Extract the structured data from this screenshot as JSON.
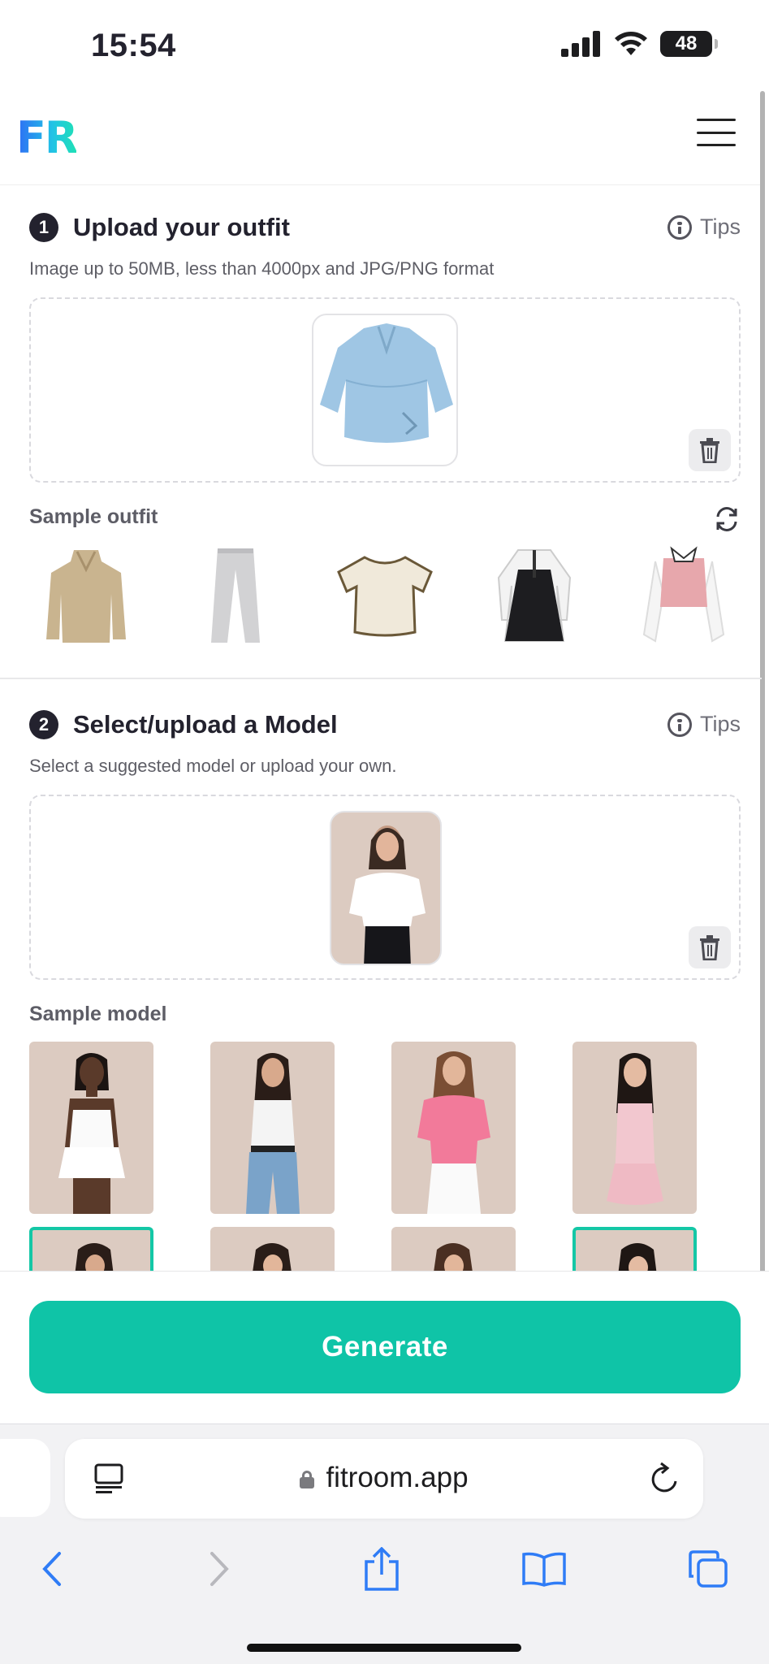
{
  "status_bar": {
    "time": "15:54",
    "battery": "48"
  },
  "header": {
    "logo": "FR"
  },
  "section1": {
    "number": "1",
    "title": "Upload your outfit",
    "tips_label": "Tips",
    "description": "Image up to 50MB, less than 4000px and JPG/PNG format",
    "sample_title": "Sample outfit",
    "sample_items": [
      "sweater",
      "trousers",
      "crop-top",
      "dress",
      "blouse"
    ]
  },
  "section2": {
    "number": "2",
    "title": "Select/upload a Model",
    "tips_label": "Tips",
    "description": "Select a suggested model or upload your own.",
    "sample_title": "Sample model"
  },
  "generate": {
    "label": "Generate"
  },
  "browser": {
    "url": "fitroom.app"
  },
  "colors": {
    "accent": "#0fc4a7",
    "dark": "#23222e",
    "model_bg": "#dccbc1"
  }
}
